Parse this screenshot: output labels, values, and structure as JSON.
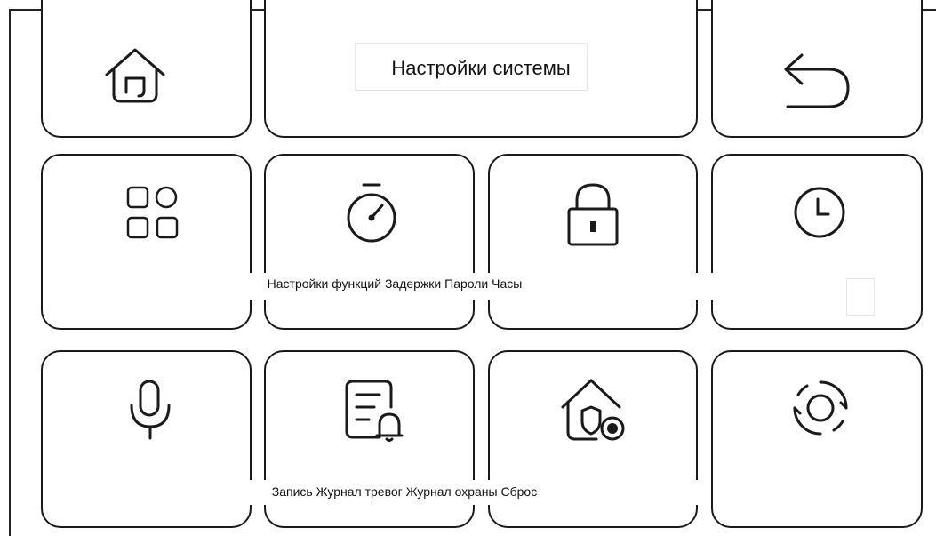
{
  "header": {
    "title": "Настройки системы",
    "home_icon": "home-icon",
    "back_icon": "back-arrow-icon"
  },
  "row1": {
    "label_text": "Настройки функций Задержки Пароли Часы",
    "items": [
      {
        "label": "Настройки функций",
        "icon": "grid-icon"
      },
      {
        "label": "Задержки",
        "icon": "stopwatch-icon"
      },
      {
        "label": "Пароли",
        "icon": "lock-icon"
      },
      {
        "label": "Часы",
        "icon": "clock-icon"
      }
    ]
  },
  "row2": {
    "label_text": "Запись Журнал тревог Журнал охраны Сброс",
    "items": [
      {
        "label": "Запись",
        "icon": "microphone-icon"
      },
      {
        "label": "Журнал тревог",
        "icon": "alarm-log-icon"
      },
      {
        "label": "Журнал охраны",
        "icon": "security-log-icon"
      },
      {
        "label": "Сброс",
        "icon": "reset-icon"
      }
    ]
  },
  "colors": {
    "stroke": "#1a1a1a",
    "background": "#ffffff"
  }
}
